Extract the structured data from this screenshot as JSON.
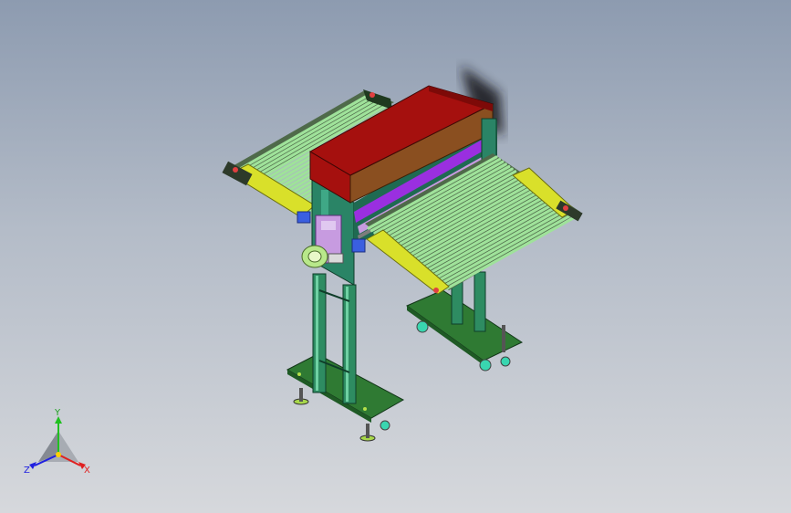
{
  "colors": {
    "background_top": "#8d9bb0",
    "background_bottom": "#d6d8dc",
    "housing_red": "#a5100e",
    "housing_brown": "#8a4f20",
    "frame_teal": "#2a8466",
    "roller_green": "#9fe29a",
    "rail_yellow": "#d9e02a",
    "base_plate_green": "#2f7a33",
    "violet_bar": "#9a2fe0",
    "lilac_part": "#c79be0",
    "motor_green": "#b8e88a",
    "blue_block": "#3a5fe0",
    "caster_teal": "#39d6b0"
  },
  "triad": {
    "x_label": "X",
    "y_label": "Y",
    "z_label": "Z",
    "x_color": "#e02020",
    "y_color": "#20c020",
    "z_color": "#2020e0"
  }
}
